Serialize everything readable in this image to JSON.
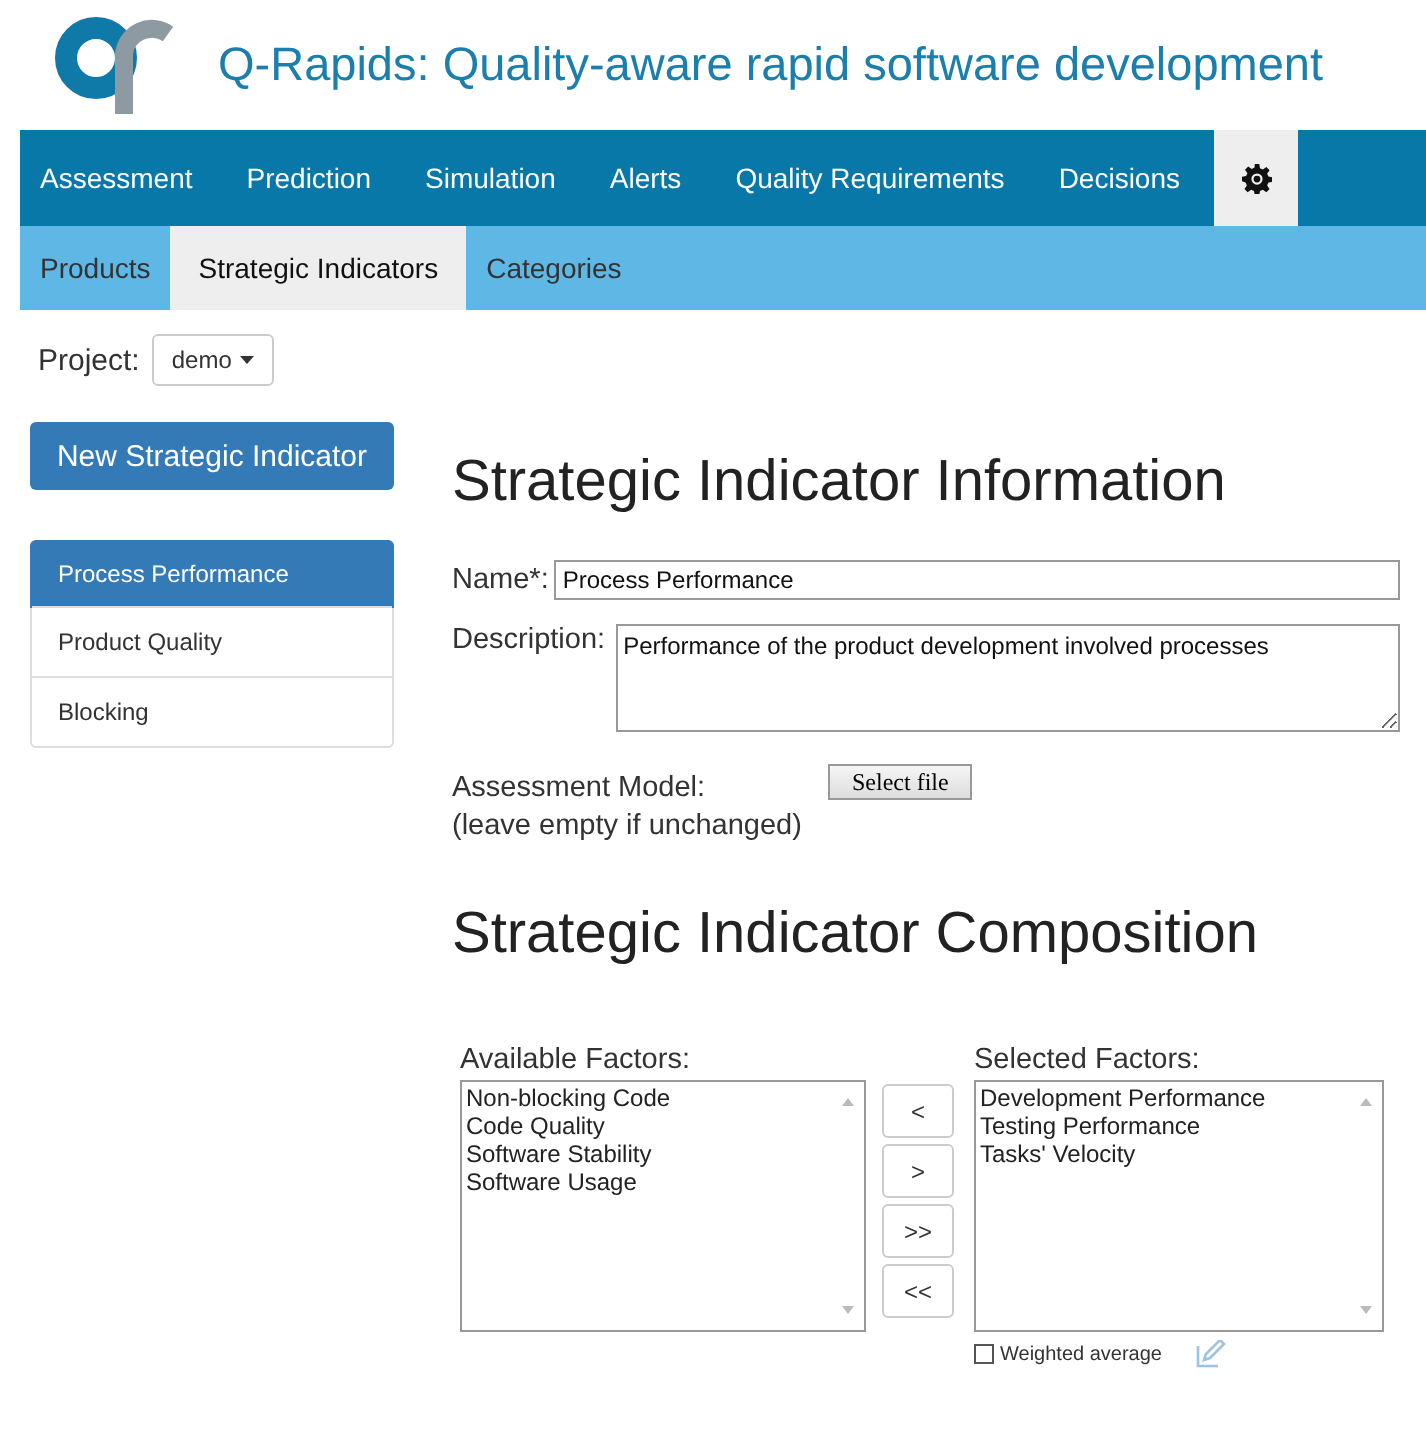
{
  "header": {
    "title": "Q-Rapids: Quality-aware rapid software development"
  },
  "nav": [
    {
      "label": "Assessment",
      "selected": false
    },
    {
      "label": "Prediction",
      "selected": false
    },
    {
      "label": "Simulation",
      "selected": false
    },
    {
      "label": "Alerts",
      "selected": false
    },
    {
      "label": "Quality Requirements",
      "selected": false
    },
    {
      "label": "Decisions",
      "selected": false
    },
    {
      "kind": "settings",
      "selected": true
    }
  ],
  "subnav": [
    {
      "label": "Products",
      "selected": false
    },
    {
      "label": "Strategic Indicators",
      "selected": true
    },
    {
      "label": "Categories",
      "selected": false
    }
  ],
  "project": {
    "label": "Project:",
    "value": "demo"
  },
  "new_button": "New Strategic Indicator",
  "indicators": [
    {
      "label": "Process Performance",
      "selected": true
    },
    {
      "label": "Product Quality",
      "selected": false
    },
    {
      "label": "Blocking",
      "selected": false
    }
  ],
  "info": {
    "heading": "Strategic Indicator Information",
    "name_label": "Name*:",
    "name_value": "Process Performance",
    "description_label": "Description:",
    "description_value": "Performance of the product development involved processes",
    "model_label": "Assessment Model:",
    "model_hint": "(leave empty if unchanged)",
    "file_button": "Select file"
  },
  "composition": {
    "heading": "Strategic Indicator Composition",
    "available_label": "Available Factors:",
    "available": [
      "Non-blocking Code",
      "Code Quality",
      "Software Stability",
      "Software Usage"
    ],
    "buttons": [
      "<",
      ">",
      ">>",
      "<<"
    ],
    "selected_label": "Selected Factors:",
    "selected": [
      "Development Performance",
      "Testing Performance",
      "Tasks' Velocity"
    ],
    "weighted": {
      "label": "Weighted average",
      "checked": false
    }
  }
}
